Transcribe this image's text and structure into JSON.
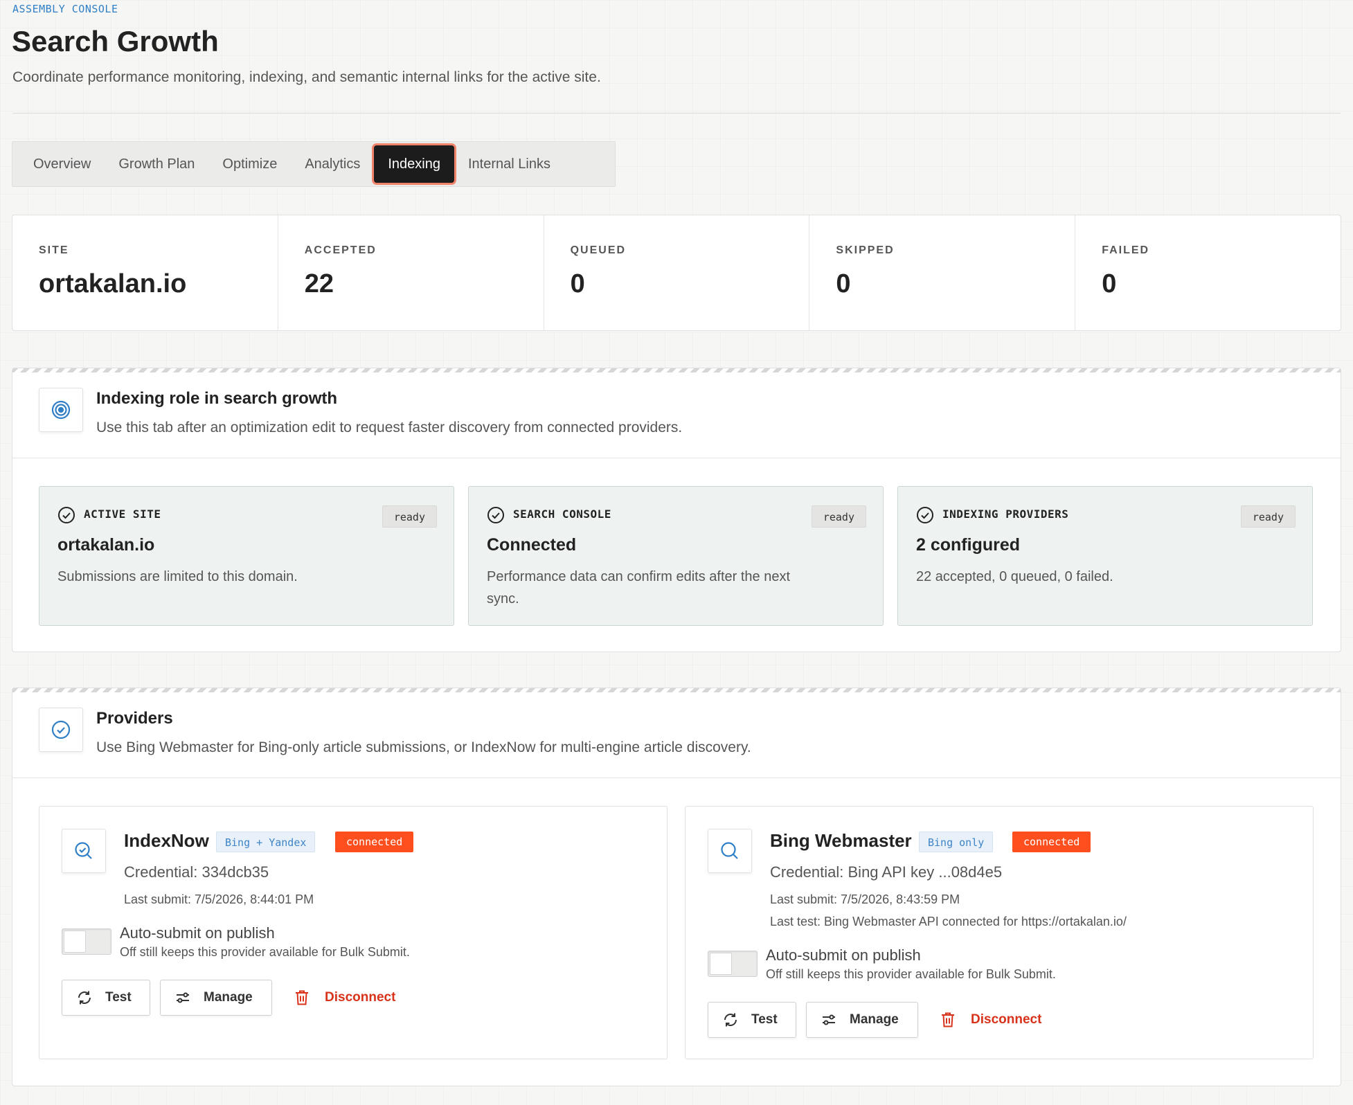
{
  "header": {
    "eyebrow": "ASSEMBLY CONSOLE",
    "title": "Search Growth",
    "subtitle": "Coordinate performance monitoring, indexing, and semantic internal links for the active site."
  },
  "tabs": [
    {
      "label": "Overview",
      "active": false
    },
    {
      "label": "Growth Plan",
      "active": false
    },
    {
      "label": "Optimize",
      "active": false
    },
    {
      "label": "Analytics",
      "active": false
    },
    {
      "label": "Indexing",
      "active": true
    },
    {
      "label": "Internal Links",
      "active": false
    }
  ],
  "stats": [
    {
      "label": "SITE",
      "value": "ortakalan.io"
    },
    {
      "label": "ACCEPTED",
      "value": "22"
    },
    {
      "label": "QUEUED",
      "value": "0"
    },
    {
      "label": "SKIPPED",
      "value": "0"
    },
    {
      "label": "FAILED",
      "value": "0"
    }
  ],
  "role_panel": {
    "icon": "target-icon",
    "title": "Indexing role in search growth",
    "description": "Use this tab after an optimization edit to request faster discovery from connected providers.",
    "cards": [
      {
        "label": "ACTIVE SITE",
        "badge": "ready",
        "value": "ortakalan.io",
        "description": "Submissions are limited to this domain."
      },
      {
        "label": "SEARCH CONSOLE",
        "badge": "ready",
        "value": "Connected",
        "description": "Performance data can confirm edits after the next sync."
      },
      {
        "label": "INDEXING PROVIDERS",
        "badge": "ready",
        "value": "2 configured",
        "description": "22 accepted, 0 queued, 0 failed."
      }
    ]
  },
  "providers_panel": {
    "icon": "check-circle-icon",
    "title": "Providers",
    "description": "Use Bing Webmaster for Bing-only article submissions, or IndexNow for multi-engine article discovery.",
    "providers": [
      {
        "icon": "search-check-icon",
        "name": "IndexNow",
        "tag": "Bing + Yandex",
        "status": "connected",
        "credential": "Credential: 334dcb35",
        "last_submit": "Last submit: 7/5/2026, 8:44:01 PM",
        "last_test": "",
        "auto_submit_label": "Auto-submit on publish",
        "auto_submit_hint": "Off still keeps this provider available for Bulk Submit.",
        "auto_submit_on": false,
        "test_label": "Test",
        "manage_label": "Manage",
        "disconnect_label": "Disconnect"
      },
      {
        "icon": "search-icon",
        "name": "Bing Webmaster",
        "tag": "Bing only",
        "status": "connected",
        "credential": "Credential: Bing API key ...08d4e5",
        "last_submit": "Last submit: 7/5/2026, 8:43:59 PM",
        "last_test": "Last test: Bing Webmaster API connected for https://ortakalan.io/",
        "auto_submit_label": "Auto-submit on publish",
        "auto_submit_hint": "Off still keeps this provider available for Bulk Submit.",
        "auto_submit_on": false,
        "test_label": "Test",
        "manage_label": "Manage",
        "disconnect_label": "Disconnect"
      }
    ]
  },
  "colors": {
    "accent_blue": "#2f7fc7",
    "connected_orange": "#ff4f1f",
    "danger_red": "#d8321b",
    "active_tab": "#1c1c1c",
    "active_tab_ring": "#f2836b",
    "status_card_bg": "#eef3f1"
  }
}
